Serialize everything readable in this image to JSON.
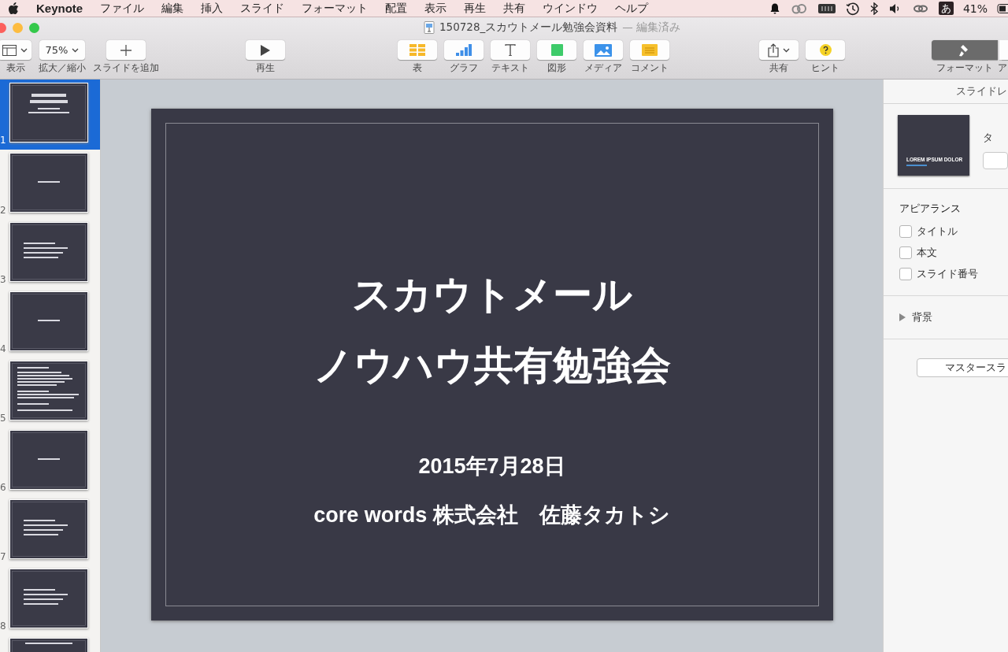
{
  "menu_bar": {
    "app": "Keynote",
    "items": [
      "ファイル",
      "編集",
      "挿入",
      "スライド",
      "フォーマット",
      "配置",
      "表示",
      "再生",
      "共有",
      "ウインドウ",
      "ヘルプ"
    ],
    "input_mode": "あ",
    "battery": "41%"
  },
  "window": {
    "title": "150728_スカウトメール勉強会資料",
    "status": "— 編集済み"
  },
  "toolbar": [
    {
      "kind": "view",
      "label": "表示"
    },
    {
      "kind": "zoom",
      "label": "拡大／縮小",
      "value": "75%"
    },
    {
      "kind": "add",
      "label": "スライドを追加"
    },
    {
      "kind": "play",
      "label": "再生"
    },
    {
      "kind": "table",
      "label": "表"
    },
    {
      "kind": "chart",
      "label": "グラフ"
    },
    {
      "kind": "text",
      "label": "テキスト"
    },
    {
      "kind": "shape",
      "label": "図形"
    },
    {
      "kind": "media",
      "label": "メディア"
    },
    {
      "kind": "comment",
      "label": "コメント"
    },
    {
      "kind": "share",
      "label": "共有"
    },
    {
      "kind": "hint",
      "label": "ヒント"
    },
    {
      "kind": "format",
      "label": "フォーマット",
      "selected": true
    },
    {
      "kind": "animate",
      "label": "ア",
      "selected": false
    }
  ],
  "slides": [
    {
      "number": "1",
      "kind": "title",
      "selected": true
    },
    {
      "number": "2",
      "kind": "section",
      "selected": false
    },
    {
      "number": "3",
      "kind": "list",
      "selected": false
    },
    {
      "number": "4",
      "kind": "section",
      "selected": false
    },
    {
      "number": "5",
      "kind": "text",
      "selected": false
    },
    {
      "number": "6",
      "kind": "section",
      "selected": false
    },
    {
      "number": "7",
      "kind": "list",
      "selected": false
    },
    {
      "number": "8",
      "kind": "list",
      "selected": false
    },
    {
      "kind": "heading",
      "selected": false
    }
  ],
  "slide": {
    "title": [
      "スカウトメール",
      "ノウハウ共有勉強会"
    ],
    "date": "2015年7月28日",
    "author": "core words 株式会社　佐藤タカトシ"
  },
  "inspector": {
    "header": "スライドレ",
    "layout_preview": "LOREM IPSUM DOLOR",
    "layout_label": "タ",
    "appearance_heading": "アピアランス",
    "options": [
      {
        "label": "タイトル",
        "checked": false
      },
      {
        "label": "本文",
        "checked": false
      },
      {
        "label": "スライド番号",
        "checked": false
      }
    ],
    "background": {
      "label": "背景",
      "expanded": false
    },
    "master_button": "マスタースラ"
  }
}
